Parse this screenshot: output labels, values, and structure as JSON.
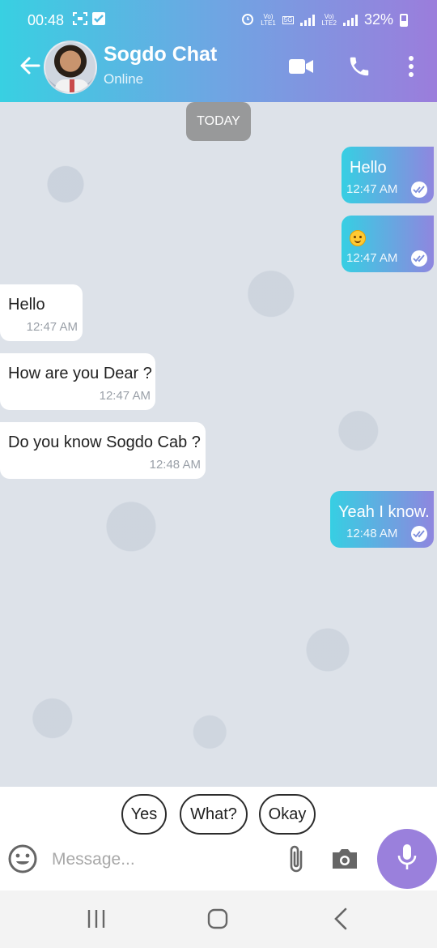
{
  "status_bar": {
    "time": "00:48",
    "battery": "32%",
    "network1": "LTE1",
    "network2": "LTE2",
    "network_type": "5G"
  },
  "header": {
    "title": "Sogdo Chat",
    "subtitle": "Online",
    "icons": [
      "back-arrow-icon",
      "video-call-icon",
      "phone-icon",
      "more-vert-icon"
    ]
  },
  "chat": {
    "date_divider": "TODAY",
    "messages": [
      {
        "direction": "outgoing",
        "text": "Hello",
        "time": "12:47 AM",
        "status": "read"
      },
      {
        "direction": "outgoing",
        "text": "",
        "emoji": "smiling-face",
        "time": "12:47 AM",
        "status": "read"
      },
      {
        "direction": "incoming",
        "text": "Hello",
        "time": "12:47 AM"
      },
      {
        "direction": "incoming",
        "text": "How are you Dear ?",
        "time": "12:47 AM"
      },
      {
        "direction": "incoming",
        "text": "Do you know Sogdo Cab ?",
        "time": "12:48 AM"
      },
      {
        "direction": "outgoing",
        "text": "Yeah I know.",
        "time": "12:48 AM",
        "status": "read"
      }
    ]
  },
  "quick_replies": [
    "Yes",
    "What?",
    "Okay"
  ],
  "composer": {
    "placeholder": "Message...",
    "icons": [
      "emoji-icon",
      "attach-icon",
      "camera-icon",
      "mic-icon"
    ]
  },
  "colors": {
    "header_start": "#38d0e2",
    "header_end": "#9b7ddc",
    "mic_button": "#9a80dc",
    "incoming_bubble": "#ffffff"
  }
}
